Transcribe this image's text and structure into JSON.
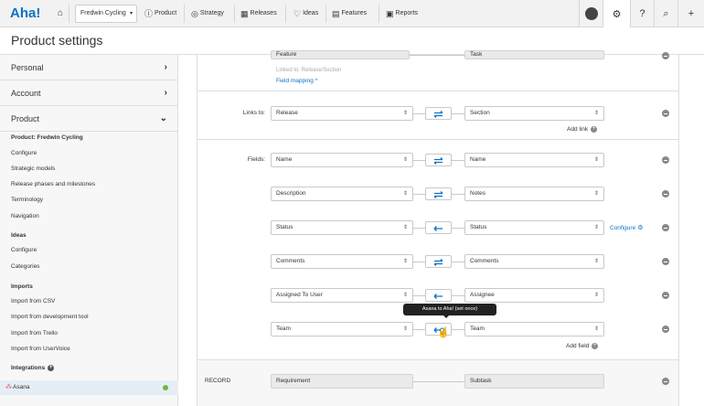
{
  "app": {
    "logo": "Aha!"
  },
  "nav": {
    "product_selector": "Fredwin Cycling",
    "items": [
      {
        "label": "Product",
        "icon": "info-icon"
      },
      {
        "label": "Strategy",
        "icon": "target-icon"
      },
      {
        "label": "Releases",
        "icon": "calendar-icon"
      },
      {
        "label": "Ideas",
        "icon": "lightbulb-icon"
      },
      {
        "label": "Features",
        "icon": "grid-icon"
      },
      {
        "label": "Reports",
        "icon": "report-icon"
      }
    ]
  },
  "page": {
    "title": "Product settings"
  },
  "sidebar": {
    "sections": [
      {
        "label": "Personal"
      },
      {
        "label": "Account"
      },
      {
        "label": "Product"
      }
    ],
    "product_group": {
      "heading": "Product: Fredwin Cycling",
      "items": [
        "Configure",
        "Strategic models",
        "Release phases and milestones",
        "Terminology",
        "Navigation"
      ]
    },
    "ideas_group": {
      "heading": "Ideas",
      "items": [
        "Configure",
        "Categories"
      ]
    },
    "imports_group": {
      "heading": "Imports",
      "items": [
        "Import from CSV",
        "Import from development tool",
        "Import from Trello",
        "Import from UserVoice"
      ]
    },
    "integrations_group": {
      "heading": "Integrations",
      "active_item": "Asana"
    }
  },
  "mapping": {
    "top_partial": {
      "left": "Feature",
      "right": "Task",
      "linked_to": "Linked to: Release/Section",
      "field_mapping": "Field mapping ^"
    },
    "links_label": "Links to:",
    "link": {
      "left": "Release",
      "right": "Section"
    },
    "add_link": "Add link",
    "fields_label": "Fields:",
    "fields": [
      {
        "left": "Name",
        "right": "Name",
        "direction": "both"
      },
      {
        "left": "Description",
        "right": "Notes",
        "direction": "both"
      },
      {
        "left": "Status",
        "right": "Status",
        "direction": "left",
        "configure": "Configure"
      },
      {
        "left": "Comments",
        "right": "Comments",
        "direction": "both"
      },
      {
        "left": "Assigned To User",
        "right": "Assignee",
        "direction": "left"
      },
      {
        "left": "Team",
        "right": "Team",
        "direction": "left-once"
      }
    ],
    "tooltip": "Asana to Aha! (set once)",
    "add_field": "Add field",
    "record": {
      "label": "RECORD",
      "left": "Requirement",
      "right": "Subtask"
    }
  },
  "colors": {
    "accent": "#0b73c4",
    "active_bg": "#e6eef5",
    "status_dot": "#6fb540"
  }
}
